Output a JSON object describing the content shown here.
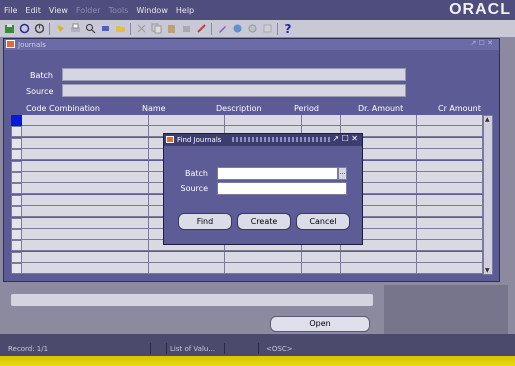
{
  "menubar": {
    "items": [
      "File",
      "Edit",
      "View",
      "Folder",
      "Tools",
      "Window",
      "Help"
    ],
    "disabled": [
      false,
      false,
      false,
      true,
      true,
      false,
      false
    ],
    "brand": "ORACL"
  },
  "toolbar": {
    "icons": [
      "save-icon",
      "navigate-icon",
      "zoom-icon",
      "attachment-icon",
      "print-icon",
      "find-icon",
      "flashlight-icon",
      "cut-icon",
      "copy-icon",
      "paste-icon",
      "clear-icon",
      "delete-icon",
      "edit-icon",
      "folder-icon",
      "translation-icon",
      "attach-icon",
      "help-icon"
    ],
    "help_glyph": "?"
  },
  "journals_window": {
    "title": "Journals",
    "controls": "↗ ☐ ✕",
    "batch_label": "Batch",
    "source_label": "Source",
    "columns": [
      "Code Combination",
      "Name",
      "Description",
      "Period",
      "Dr. Amount",
      "Cr Amount"
    ],
    "open_label": "Open"
  },
  "find_dialog": {
    "title": "Find Journals",
    "controls": "↗ ☐ ✕",
    "batch_label": "Batch",
    "source_label": "Source",
    "batch_value": "",
    "source_value": "",
    "lov_glyph": "...",
    "buttons": [
      "Find",
      "Create",
      "Cancel"
    ]
  },
  "statusbar": {
    "record": "Record: 1/1",
    "list_of_values": "List of Valu...",
    "osc": "<OSC>"
  },
  "colors": {
    "window_bg": "#5d5b96",
    "menubar_bg": "#4f4d7e",
    "selected_cell": "#0a18d8",
    "bottom_strip": "#e0d200"
  }
}
